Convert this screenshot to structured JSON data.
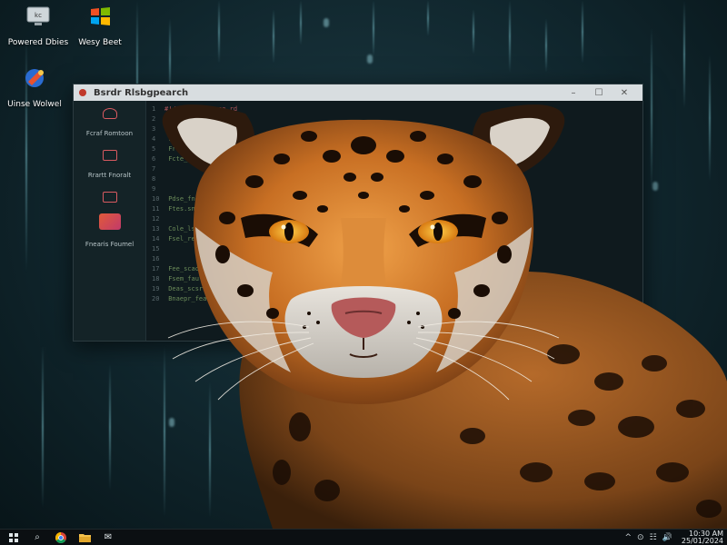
{
  "desktop": {
    "icons": [
      {
        "label": "Powered Dbies",
        "icon": "computer-icon"
      },
      {
        "label": "Wesy Beet",
        "icon": "windows-logo-icon"
      },
      {
        "label": "Uinse Wolwel",
        "icon": "app-shortcut-icon"
      }
    ]
  },
  "window": {
    "title": "Bsrdr Rlsbgpearch",
    "controls": {
      "minimize": "–",
      "maximize": "☐",
      "close": "✕"
    },
    "sidebar": [
      {
        "label": "Fcraf Romtoon",
        "icon": "heart-icon"
      },
      {
        "label": "Rrartt Fnoralt",
        "icon": "window-icon"
      },
      {
        "label": "",
        "icon": "window-small-icon"
      },
      {
        "label": "Fnearis Foumel",
        "icon": "photo-icon"
      }
    ],
    "code_lines": [
      {
        "n": "1",
        "t": "#!/Fasthon.proce rd",
        "red": true
      },
      {
        "n": "2",
        "t": ""
      },
      {
        "n": "3",
        "t": "  dle caarce"
      },
      {
        "n": "4",
        "t": "  Flor_ctsae.fvp"
      },
      {
        "n": "5",
        "t": "  Fror_sie_scerv("
      },
      {
        "n": "6",
        "t": "  Fcte_seve_soxt)"
      },
      {
        "n": "7",
        "t": ""
      },
      {
        "n": "8",
        "t": ""
      },
      {
        "n": "9",
        "t": ""
      },
      {
        "n": "10",
        "t": "  Pdse_fnoce;"
      },
      {
        "n": "11",
        "t": "  Ftes.sne.pcce()"
      },
      {
        "n": "12",
        "t": ""
      },
      {
        "n": "13",
        "t": "  Cole_lsanrcer("
      },
      {
        "n": "14",
        "t": "  Fsel_reade()"
      },
      {
        "n": "15",
        "t": ""
      },
      {
        "n": "16",
        "t": ""
      },
      {
        "n": "17",
        "t": "  Fee_scaodde"
      },
      {
        "n": "18",
        "t": "  Fsem_faule."
      },
      {
        "n": "19",
        "t": "  Deas_scsrroc"
      },
      {
        "n": "20",
        "t": "  Bnaepr_feat"
      }
    ]
  },
  "taskbar": {
    "start": "start-icon",
    "apps": [
      {
        "icon": "search-icon",
        "glyph": "⌕"
      },
      {
        "icon": "chrome-icon",
        "glyph": ""
      },
      {
        "icon": "file-explorer-icon",
        "glyph": ""
      },
      {
        "icon": "mail-icon",
        "glyph": "✉"
      }
    ],
    "tray": [
      "^",
      "⊙",
      "☷",
      "🔊"
    ],
    "time": "10:30 AM",
    "date": "25/01/2024"
  },
  "colors": {
    "desktop_bg": "#0e2127",
    "window_bg": "#0f1a1e",
    "accent_red": "#d85a60",
    "taskbar_bg": "#0b0f12"
  }
}
